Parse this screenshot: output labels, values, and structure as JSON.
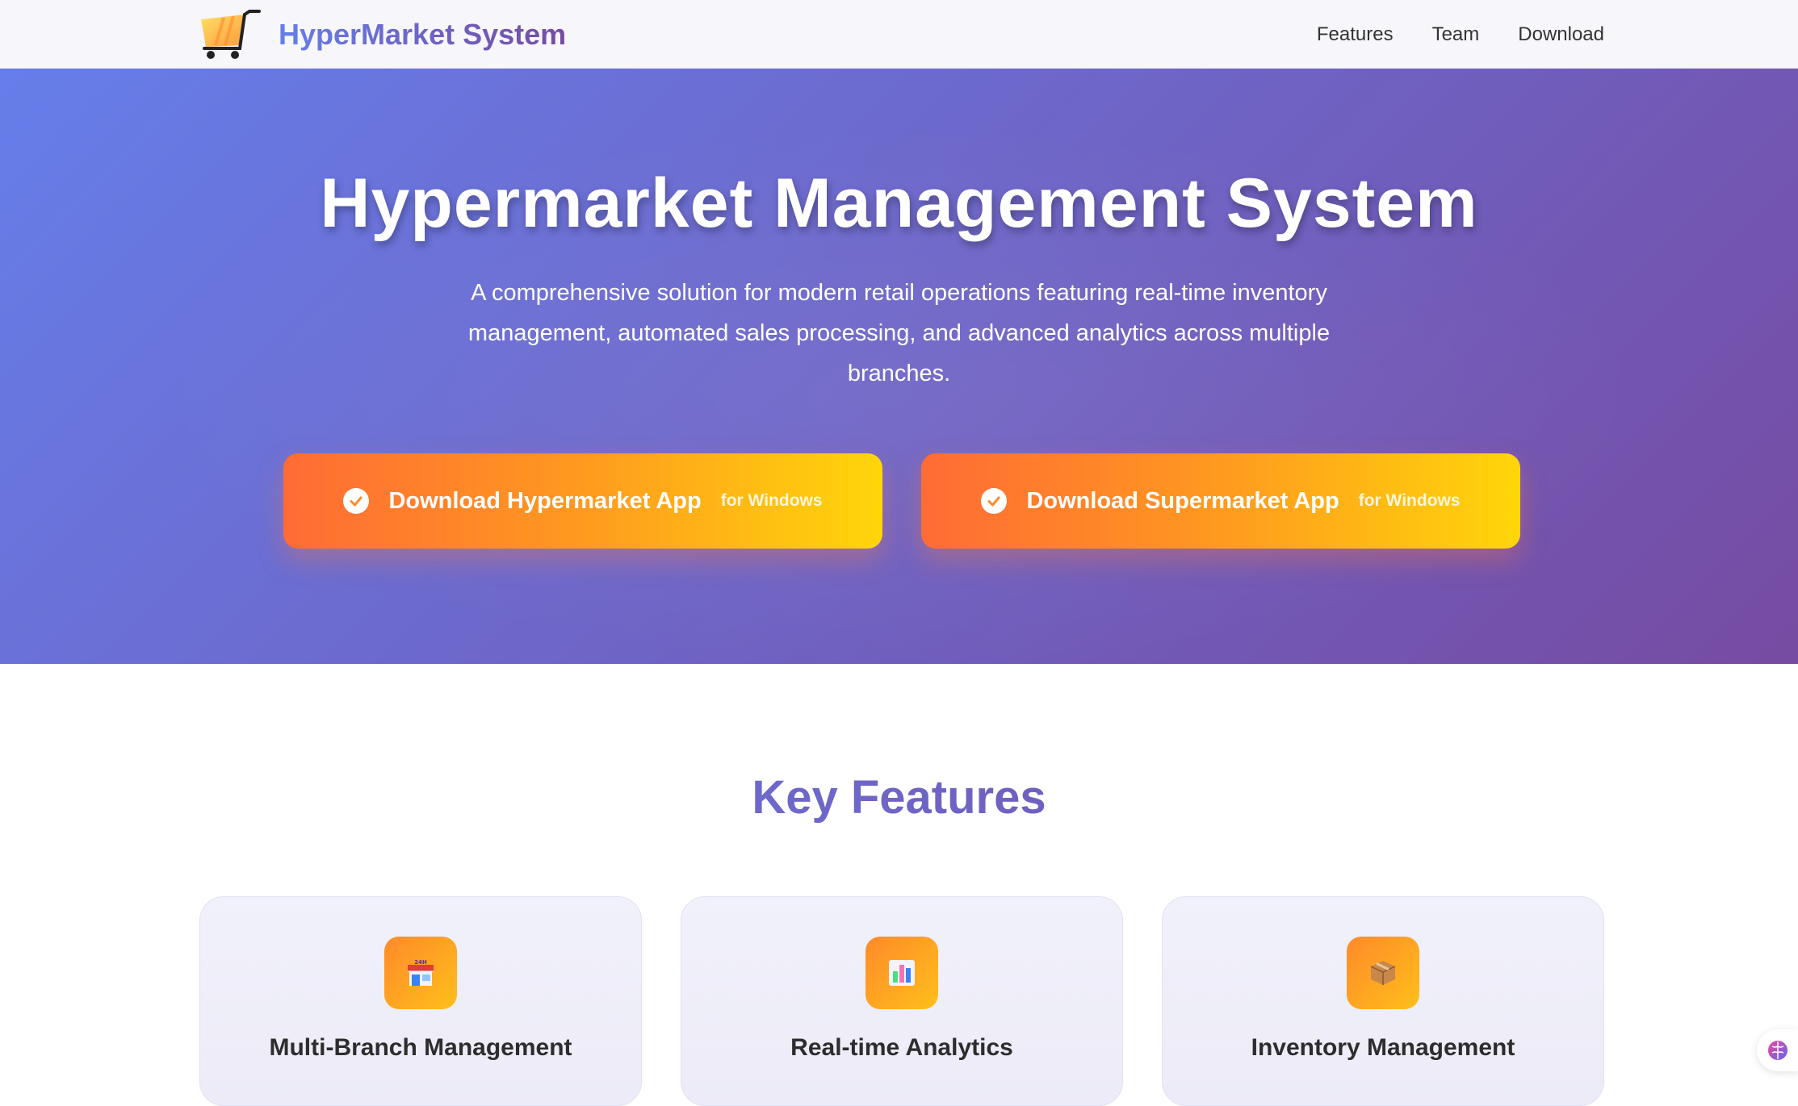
{
  "nav": {
    "brand": "HyperMarket System",
    "links": [
      "Features",
      "Team",
      "Download"
    ]
  },
  "hero": {
    "title": "Hypermarket Management System",
    "subtitle": "A comprehensive solution for modern retail operations featuring real-time inventory management, automated sales processing, and advanced analytics across multiple branches.",
    "buttons": [
      {
        "label": "Download Hypermarket App",
        "sub": "for Windows"
      },
      {
        "label": "Download Supermarket App",
        "sub": "for Windows"
      }
    ]
  },
  "features": {
    "title": "Key Features",
    "cards": [
      {
        "title": "Multi-Branch Management",
        "icon": "store-icon"
      },
      {
        "title": "Real-time Analytics",
        "icon": "bar-chart-icon"
      },
      {
        "title": "Inventory Management",
        "icon": "package-icon"
      }
    ]
  },
  "colors": {
    "hero_gradient_start": "#667eea",
    "hero_gradient_end": "#764ba2",
    "button_gradient_start": "#ff6b35",
    "button_gradient_end": "#ffd60a",
    "feature_icon_bg": "#ff9a1f"
  }
}
